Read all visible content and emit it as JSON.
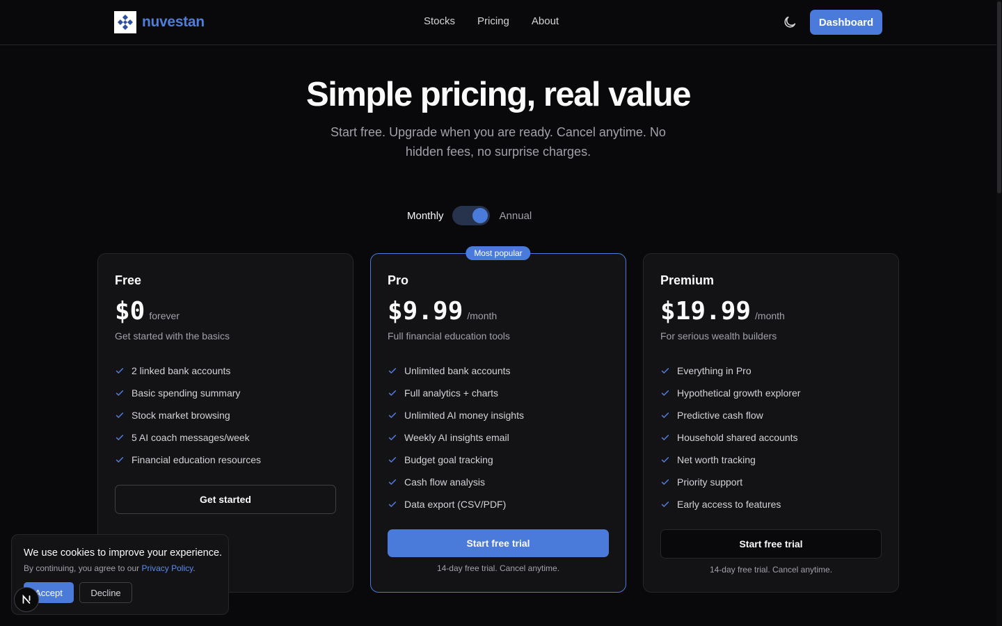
{
  "header": {
    "brand": "nuvestan",
    "nav": [
      {
        "label": "Stocks"
      },
      {
        "label": "Pricing"
      },
      {
        "label": "About"
      }
    ],
    "dashboard_label": "Dashboard"
  },
  "hero": {
    "title": "Simple pricing, real value",
    "subtitle": "Start free. Upgrade when you are ready. Cancel anytime. No hidden fees, no surprise charges."
  },
  "billing": {
    "monthly": "Monthly",
    "annual": "Annual",
    "selected": "Annual"
  },
  "plans": [
    {
      "name": "Free",
      "price": "$0",
      "period": "forever",
      "description": "Get started with the basics",
      "features": [
        "2 linked bank accounts",
        "Basic spending summary",
        "Stock market browsing",
        "5 AI coach messages/week",
        "Financial education resources"
      ],
      "cta": "Get started"
    },
    {
      "name": "Pro",
      "badge": "Most popular",
      "price": "$9.99",
      "period": "/month",
      "description": "Full financial education tools",
      "features": [
        "Unlimited bank accounts",
        "Full analytics + charts",
        "Unlimited AI money insights",
        "Weekly AI insights email",
        "Budget goal tracking",
        "Cash flow analysis",
        "Data export (CSV/PDF)"
      ],
      "cta": "Start free trial",
      "note": "14-day free trial. Cancel anytime."
    },
    {
      "name": "Premium",
      "price": "$19.99",
      "period": "/month",
      "description": "For serious wealth builders",
      "features": [
        "Everything in Pro",
        "Hypothetical growth explorer",
        "Predictive cash flow",
        "Household shared accounts",
        "Net worth tracking",
        "Priority support",
        "Early access to features"
      ],
      "cta": "Start free trial",
      "note": "14-day free trial. Cancel anytime."
    }
  ],
  "cookie": {
    "title": "We use cookies to improve your experience.",
    "text": "By continuing, you agree to our",
    "link": "Privacy Policy",
    "accept": "Accept",
    "decline": "Decline"
  },
  "icons": {
    "logo": "diamond-grid-logo-icon",
    "theme": "moon-icon",
    "check": "check-icon",
    "dev": "next-n-icon"
  },
  "colors": {
    "accent": "#4a7bdb",
    "background": "#09090b",
    "card": "#131316"
  }
}
